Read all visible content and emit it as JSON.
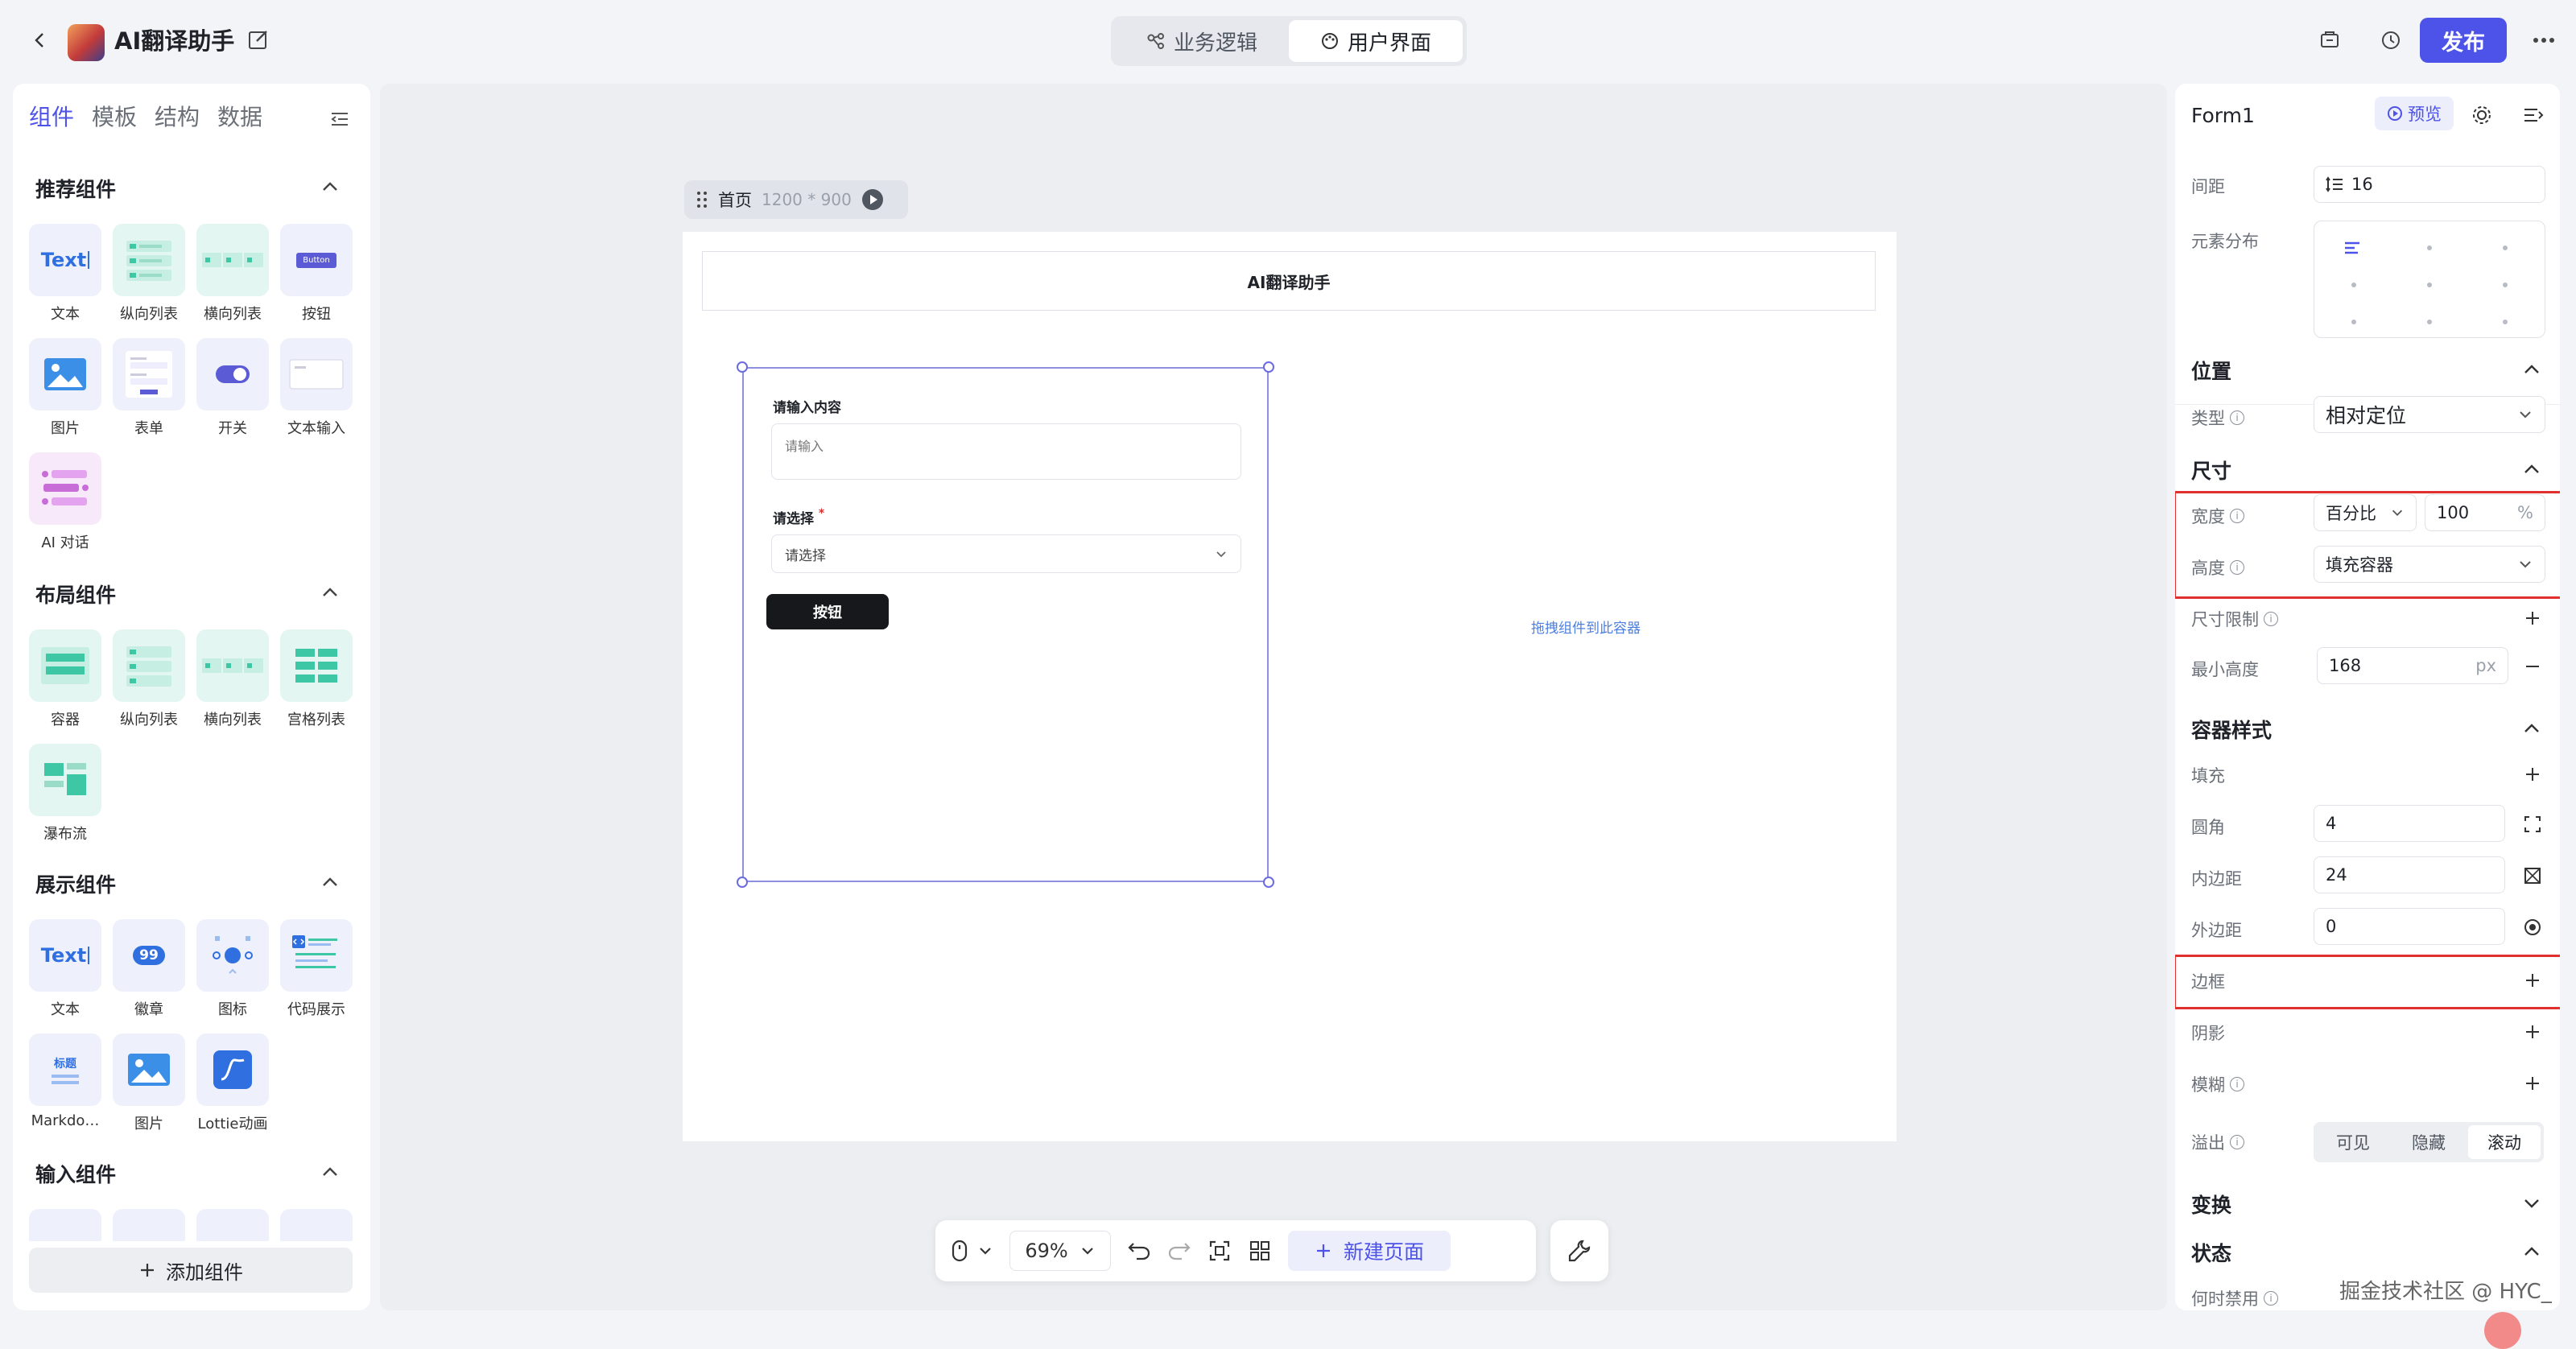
{
  "app": {
    "title": "AI翻译助手"
  },
  "view_switch": {
    "logic": "业务逻辑",
    "ui": "用户界面"
  },
  "header": {
    "publish": "发布"
  },
  "left_panel": {
    "tabs": [
      "组件",
      "模板",
      "结构",
      "数据"
    ],
    "sections": {
      "recommended": "推荐组件",
      "layout": "布局组件",
      "display": "展示组件",
      "input": "输入组件"
    },
    "recommended_items": [
      "文本",
      "纵向列表",
      "横向列表",
      "按钮",
      "图片",
      "表单",
      "开关",
      "文本输入",
      "AI 对话"
    ],
    "layout_items": [
      "容器",
      "纵向列表",
      "横向列表",
      "宫格列表",
      "瀑布流"
    ],
    "display_items": [
      "文本",
      "徽章",
      "图标",
      "代码展示",
      "Markdo…",
      "图片",
      "Lottie动画"
    ],
    "icon_texts": {
      "text": "Text",
      "button": "Button",
      "badge": "99",
      "md_title": "标题"
    },
    "add_component": "添加组件"
  },
  "canvas": {
    "page_name": "首页",
    "page_size": "1200 * 900",
    "page_title": "AI翻译助手",
    "form": {
      "label_input": "请输入内容",
      "input_placeholder": "请输入",
      "label_select": "请选择",
      "required_mark": "*",
      "select_placeholder": "请选择",
      "button": "按钮"
    },
    "drop_hint": "拖拽组件到此容器"
  },
  "toolbar": {
    "zoom": "69%",
    "new_page": "新建页面"
  },
  "right_panel": {
    "component_name": "Form1",
    "preview": "预览",
    "spacing_label": "间距",
    "spacing_value": "16",
    "distribution_label": "元素分布",
    "position_section": "位置",
    "type_label": "类型",
    "type_value": "相对定位",
    "size_section": "尺寸",
    "width_label": "宽度",
    "width_mode": "百分比",
    "width_value": "100",
    "width_unit": "%",
    "height_label": "高度",
    "height_value": "填充容器",
    "size_limit_label": "尺寸限制",
    "min_height_label": "最小高度",
    "min_height_value": "168",
    "min_height_unit": "px",
    "container_style_section": "容器样式",
    "fill_label": "填充",
    "radius_label": "圆角",
    "radius_value": "4",
    "padding_label": "内边距",
    "padding_value": "24",
    "margin_label": "外边距",
    "margin_value": "0",
    "border_label": "边框",
    "shadow_label": "阴影",
    "blur_label": "模糊",
    "overflow_label": "溢出",
    "overflow_options": [
      "可见",
      "隐藏",
      "滚动"
    ],
    "overflow_selected": "滚动",
    "transform_section": "变换",
    "state_section": "状态",
    "disable_when_label": "何时禁用"
  },
  "watermark": "掘金技术社区 @ HYC_",
  "colors": {
    "accent": "#4d53e8",
    "highlight_red": "#e03030",
    "selection": "#8f8fe0"
  }
}
